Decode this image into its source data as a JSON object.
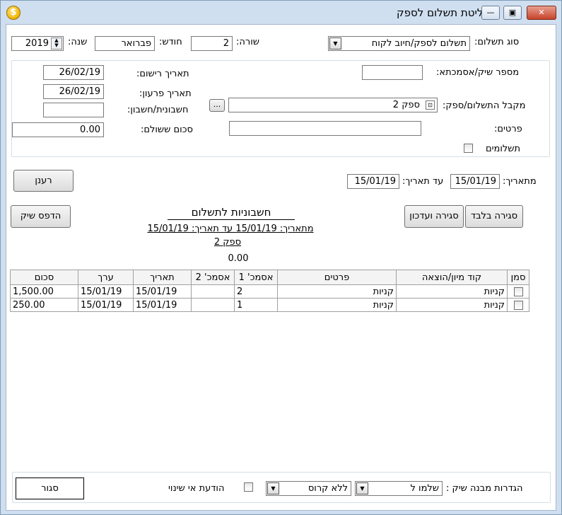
{
  "window": {
    "title": "קליטת תשלום לספק",
    "app_icon_glyph": "$",
    "close_glyph": "✕",
    "max_glyph": "▣",
    "min_glyph": "—"
  },
  "header": {
    "payment_type_label": "סוג תשלום:",
    "payment_type_value": "תשלום לספק/חיוב לקוח",
    "row_label": "שורה:",
    "row_value": "2",
    "month_label": "חודש:",
    "month_value": "פברואר",
    "year_label": "שנה:",
    "year_value": "2019"
  },
  "details": {
    "check_number_label": "מספר שיק/אסמכתא:",
    "check_number_value": "",
    "payee_label": "מקבל התשלום/ספק:",
    "payee_value": "ספק 2",
    "payee_browse": "...",
    "particulars_label": "פרטים:",
    "particulars_value": "",
    "payments_label": "תשלומים",
    "reg_date_label": "תאריך רישום:",
    "reg_date_value": "26/02/19",
    "due_date_label": "תאריך פרעון:",
    "due_date_value": "26/02/19",
    "invoice_label": "חשבונית/חשבון:",
    "invoice_value": "",
    "amount_paid_label": "סכום ששולם:",
    "amount_paid_value": "0.00"
  },
  "filter": {
    "from_date_label": "מתאריך:",
    "from_date_value": "15/01/19",
    "to_date_label": "עד תאריך:",
    "to_date_value": "15/01/19",
    "refresh_label": "רענן"
  },
  "actions": {
    "close_only_label": "סגירה בלבד",
    "close_update_label": "סגירה ועדכון",
    "print_check_label": "הדפס שיק"
  },
  "report": {
    "title": "חשבוניות לתשלום",
    "range": "מתאריך: 15/01/19 עד תאריך: 15/01/19",
    "supplier": "ספק 2",
    "total": "0.00"
  },
  "table": {
    "columns": [
      "סמן",
      "קוד מיון/הוצאה",
      "פרטים",
      "אסמכ' 1",
      "אסמכ' 2",
      "תאריך",
      "ערך",
      "סכום"
    ],
    "rows": [
      {
        "code": "קניות",
        "details": "קניות",
        "ref1": "2",
        "ref2": "",
        "date": "15/01/19",
        "value_date": "15/01/19",
        "amount": "1,500.00"
      },
      {
        "code": "קניות",
        "details": "קניות",
        "ref1": "1",
        "ref2": "",
        "date": "15/01/19",
        "value_date": "15/01/19",
        "amount": "250.00"
      }
    ]
  },
  "footer": {
    "check_settings_label": "הגדרות מבנה שיק :",
    "check_settings_value": "שלמו ל",
    "cross_value": "ללא קרוס",
    "notify_change_label": "הודעת אי שינוי",
    "close_label": "סגור"
  }
}
